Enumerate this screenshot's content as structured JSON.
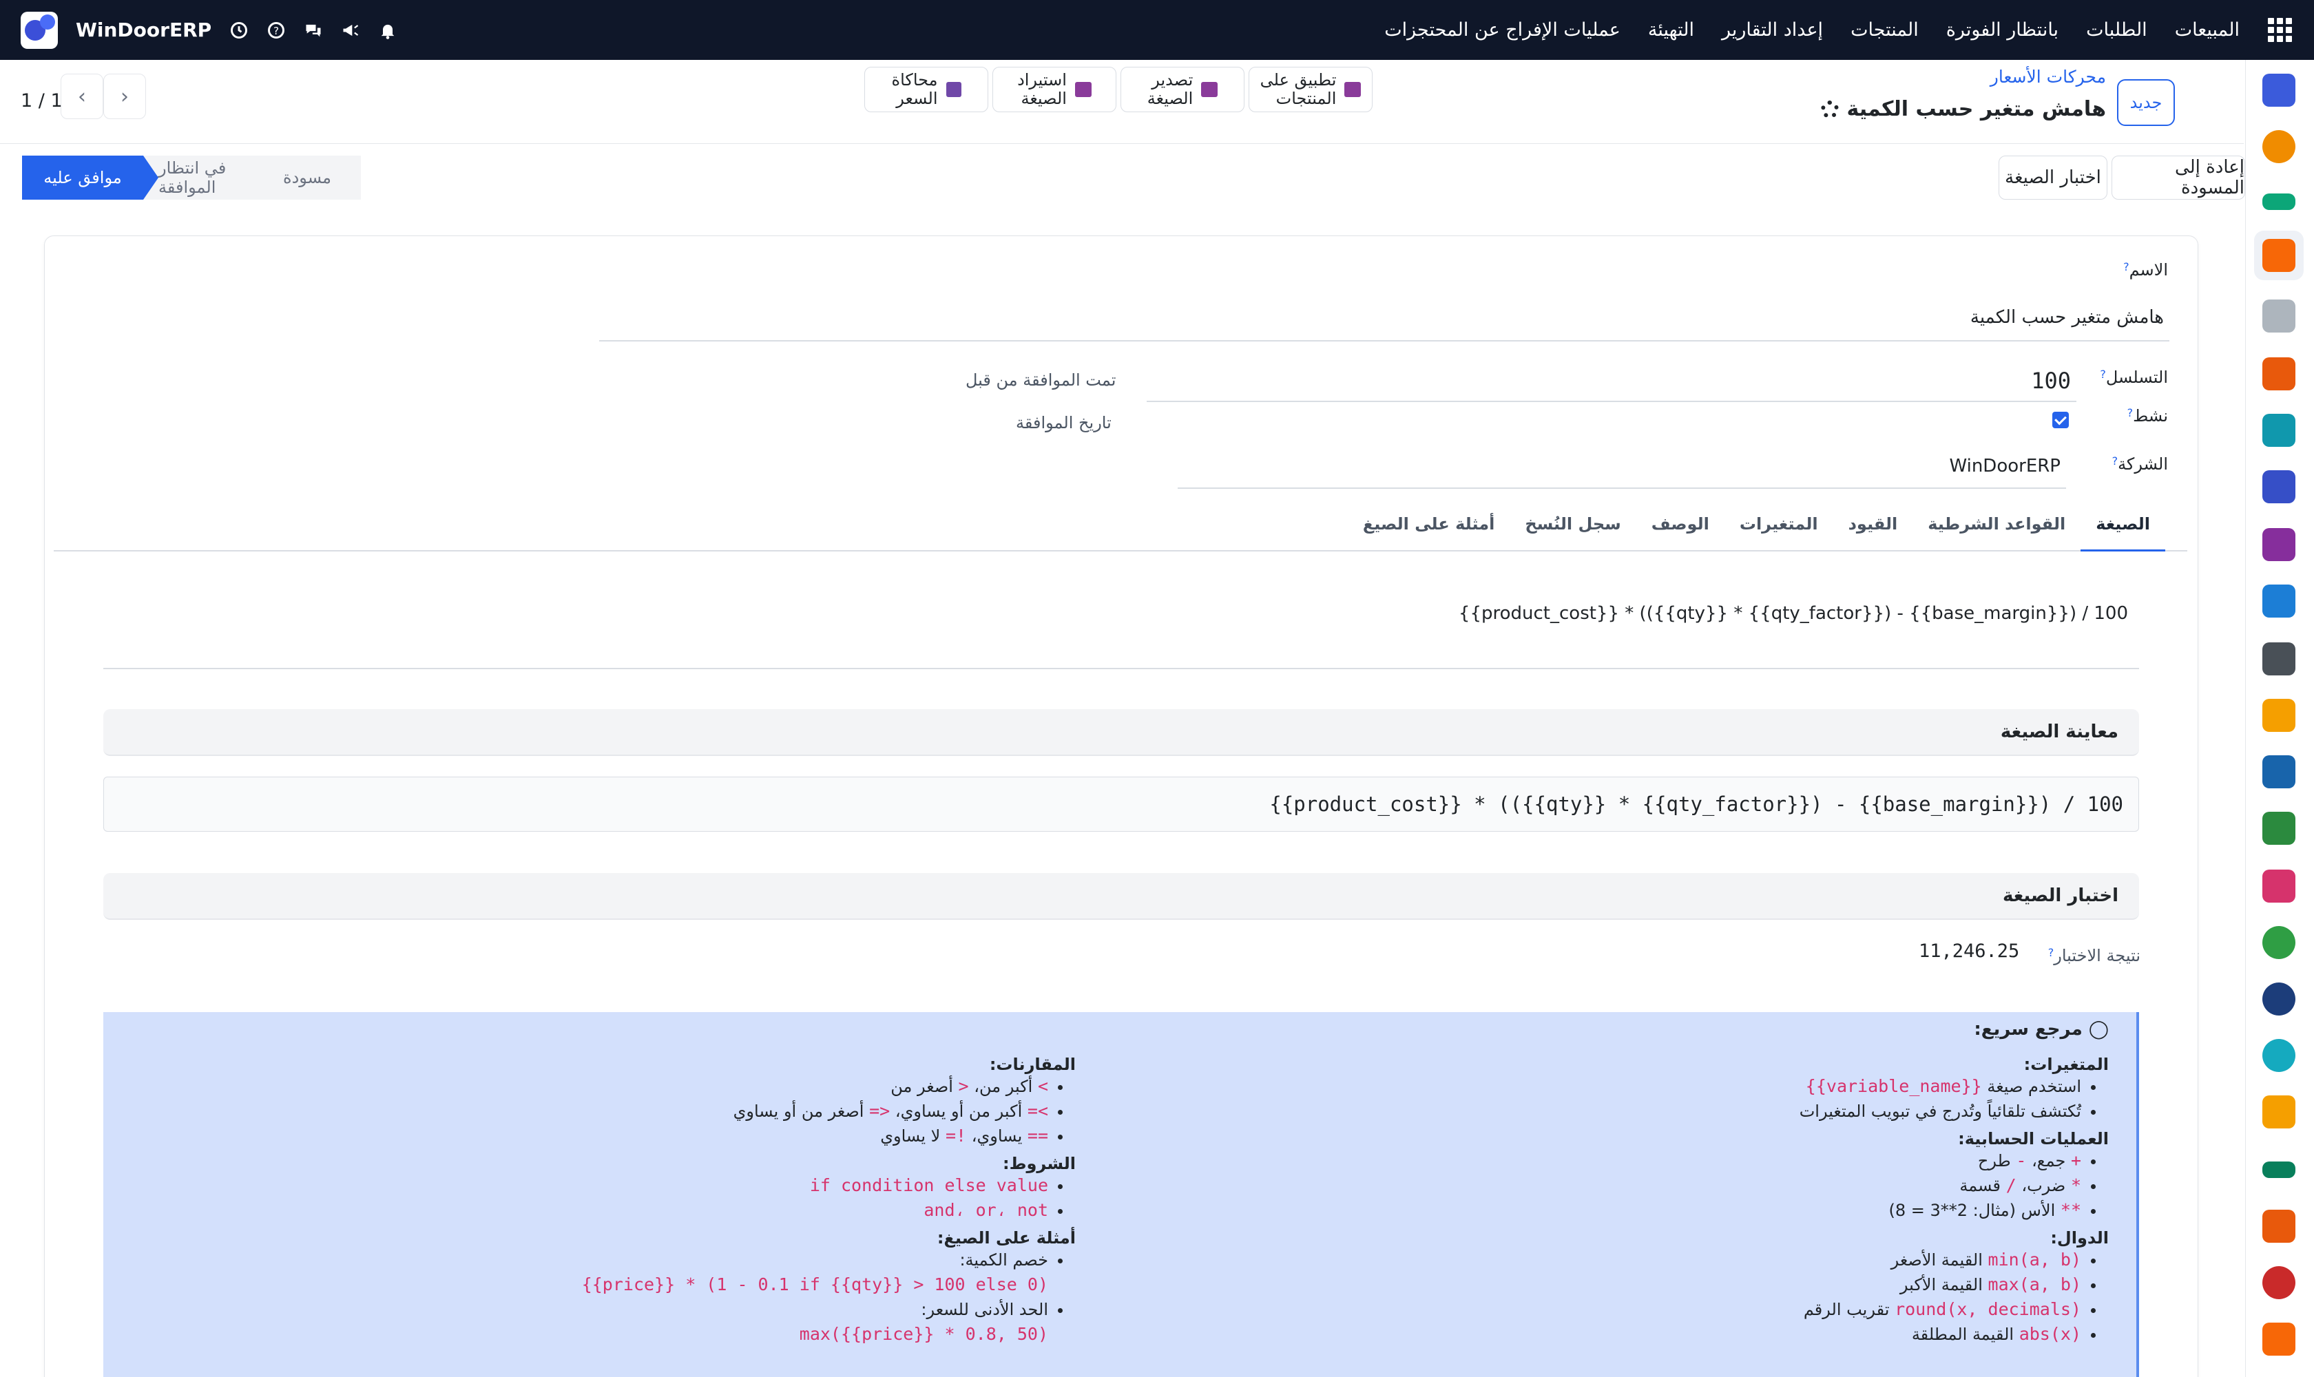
{
  "topnav": {
    "brand": "WinDoorERP",
    "menu": [
      "المبيعات",
      "الطلبات",
      "بانتظار الفوترة",
      "المنتجات",
      "إعداد التقارير",
      "التهيئة",
      "عمليات الإفراج عن المحتجزات"
    ]
  },
  "control": {
    "new_label": "جديد",
    "breadcrumb": "محركات الأسعار",
    "record_title": "هامش متغير حسب الكمية",
    "actions": [
      {
        "line1": "تطبيق على",
        "line2": "المنتجات",
        "icon": "cart-icon"
      },
      {
        "line1": "تصدير",
        "line2": "الصيغة",
        "icon": "download-icon"
      },
      {
        "line1": "استيراد",
        "line2": "الصيغة",
        "icon": "upload-icon"
      },
      {
        "line1": "محاكاة",
        "line2": "السعر",
        "icon": "calculator-icon"
      }
    ],
    "pager": "1 / 1"
  },
  "status": {
    "reset_label": "إعادة إلى المسودة",
    "test_label": "اختبار الصيغة",
    "stages": [
      "مسودة",
      "في انتظار الموافقة",
      "موافق عليه"
    ],
    "current_stage": "موافق عليه"
  },
  "form": {
    "name_label": "الاسم",
    "name_value": "هامش متغير حسب الكمية",
    "sequence_label": "التسلسل",
    "sequence_value": "100",
    "active_label": "نشط",
    "active": true,
    "company_label": "الشركة",
    "company_value": "WinDoorERP",
    "approved_by_label": "تمت الموافقة من قبل",
    "approval_date_label": "تاريخ الموافقة"
  },
  "tabs": [
    "الصيغة",
    "القواعد الشرطية",
    "القيود",
    "المتغيرات",
    "الوصف",
    "سجل النُسخ",
    "أمثلة على الصيغ"
  ],
  "active_tab": "الصيغة",
  "formula": {
    "expression": "{{product_cost}} * (({{qty}} * {{qty_factor}}) - {{base_margin}}) / 100",
    "preview_title": "معاينة الصيغة",
    "preview_code": "{{product_cost}} * (({{qty}} * {{qty_factor}}) - {{base_margin}}) / 100",
    "test_title": "اختبار الصيغة",
    "test_result_label": "نتيجة الاختبار",
    "test_result_value": "11,246.25"
  },
  "reference": {
    "title": "مرجع سريع:",
    "variables_title": "المتغيرات:",
    "var_item1_text": "استخدم صيغة",
    "var_item1_code": "{{variable_name}}",
    "var_item2": "تُكتشف تلقائياً وتُدرج في تبويب المتغيرات",
    "math_title": "العمليات الحسابية:",
    "math_add_code": "+",
    "math_add_text": "جمع،",
    "math_sub_code": "-",
    "math_sub_text": "طرح",
    "math_mul_code": "*",
    "math_mul_text": "ضرب،",
    "math_div_code": "/",
    "math_div_text": "قسمة",
    "math_pow_code": "**",
    "math_pow_text": "الأس (مثال: 2**3 = 8)",
    "functions_title": "الدوال:",
    "functions": [
      {
        "code": "min(a, b)",
        "text": "القيمة الأصغر"
      },
      {
        "code": "max(a, b)",
        "text": "القيمة الأكبر"
      },
      {
        "code": "round(x, decimals)",
        "text": "تقريب الرقم"
      },
      {
        "code": "abs(x)",
        "text": "القيمة المطلقة"
      }
    ],
    "comparisons_title": "المقارنات:",
    "cmp1_code_a": ">",
    "cmp1_text_a": "أكبر من،",
    "cmp1_code_b": "<",
    "cmp1_text_b": "أصغر من",
    "cmp2_code_a": ">=",
    "cmp2_text_a": "أكبر من أو يساوي،",
    "cmp2_code_b": "<=",
    "cmp2_text_b": "أصغر من أو يساوي",
    "cmp3_code_a": "==",
    "cmp3_text_a": "يساوي،",
    "cmp3_code_b": "!=",
    "cmp3_text_b": "لا يساوي",
    "conditions_title": "الشروط:",
    "cond1_code": "if condition else value",
    "cond2_code": "and، or، not",
    "examples_title": "أمثلة على الصيغ:",
    "ex1_text": "خصم الكمية:",
    "ex1_code": "{{price}} * (1 - 0.1 if {{qty}} > 100 else 0)",
    "ex2_text": "الحد الأدنى للسعر:",
    "ex2_code": "max({{price}} * 0.8, 50)"
  }
}
